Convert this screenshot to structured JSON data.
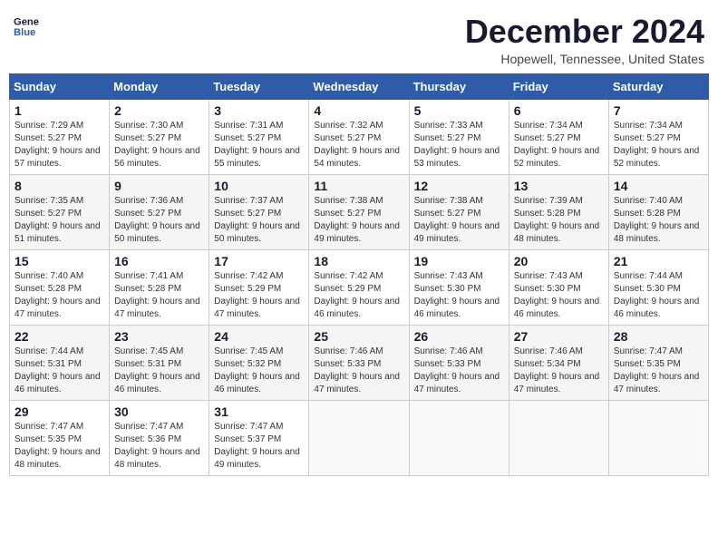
{
  "header": {
    "logo_line1": "General",
    "logo_line2": "Blue",
    "month_title": "December 2024",
    "location": "Hopewell, Tennessee, United States"
  },
  "weekdays": [
    "Sunday",
    "Monday",
    "Tuesday",
    "Wednesday",
    "Thursday",
    "Friday",
    "Saturday"
  ],
  "weeks": [
    [
      {
        "day": "1",
        "sunrise": "7:29 AM",
        "sunset": "5:27 PM",
        "daylight": "9 hours and 57 minutes."
      },
      {
        "day": "2",
        "sunrise": "7:30 AM",
        "sunset": "5:27 PM",
        "daylight": "9 hours and 56 minutes."
      },
      {
        "day": "3",
        "sunrise": "7:31 AM",
        "sunset": "5:27 PM",
        "daylight": "9 hours and 55 minutes."
      },
      {
        "day": "4",
        "sunrise": "7:32 AM",
        "sunset": "5:27 PM",
        "daylight": "9 hours and 54 minutes."
      },
      {
        "day": "5",
        "sunrise": "7:33 AM",
        "sunset": "5:27 PM",
        "daylight": "9 hours and 53 minutes."
      },
      {
        "day": "6",
        "sunrise": "7:34 AM",
        "sunset": "5:27 PM",
        "daylight": "9 hours and 52 minutes."
      },
      {
        "day": "7",
        "sunrise": "7:34 AM",
        "sunset": "5:27 PM",
        "daylight": "9 hours and 52 minutes."
      }
    ],
    [
      {
        "day": "8",
        "sunrise": "7:35 AM",
        "sunset": "5:27 PM",
        "daylight": "9 hours and 51 minutes."
      },
      {
        "day": "9",
        "sunrise": "7:36 AM",
        "sunset": "5:27 PM",
        "daylight": "9 hours and 50 minutes."
      },
      {
        "day": "10",
        "sunrise": "7:37 AM",
        "sunset": "5:27 PM",
        "daylight": "9 hours and 50 minutes."
      },
      {
        "day": "11",
        "sunrise": "7:38 AM",
        "sunset": "5:27 PM",
        "daylight": "9 hours and 49 minutes."
      },
      {
        "day": "12",
        "sunrise": "7:38 AM",
        "sunset": "5:27 PM",
        "daylight": "9 hours and 49 minutes."
      },
      {
        "day": "13",
        "sunrise": "7:39 AM",
        "sunset": "5:28 PM",
        "daylight": "9 hours and 48 minutes."
      },
      {
        "day": "14",
        "sunrise": "7:40 AM",
        "sunset": "5:28 PM",
        "daylight": "9 hours and 48 minutes."
      }
    ],
    [
      {
        "day": "15",
        "sunrise": "7:40 AM",
        "sunset": "5:28 PM",
        "daylight": "9 hours and 47 minutes."
      },
      {
        "day": "16",
        "sunrise": "7:41 AM",
        "sunset": "5:28 PM",
        "daylight": "9 hours and 47 minutes."
      },
      {
        "day": "17",
        "sunrise": "7:42 AM",
        "sunset": "5:29 PM",
        "daylight": "9 hours and 47 minutes."
      },
      {
        "day": "18",
        "sunrise": "7:42 AM",
        "sunset": "5:29 PM",
        "daylight": "9 hours and 46 minutes."
      },
      {
        "day": "19",
        "sunrise": "7:43 AM",
        "sunset": "5:30 PM",
        "daylight": "9 hours and 46 minutes."
      },
      {
        "day": "20",
        "sunrise": "7:43 AM",
        "sunset": "5:30 PM",
        "daylight": "9 hours and 46 minutes."
      },
      {
        "day": "21",
        "sunrise": "7:44 AM",
        "sunset": "5:30 PM",
        "daylight": "9 hours and 46 minutes."
      }
    ],
    [
      {
        "day": "22",
        "sunrise": "7:44 AM",
        "sunset": "5:31 PM",
        "daylight": "9 hours and 46 minutes."
      },
      {
        "day": "23",
        "sunrise": "7:45 AM",
        "sunset": "5:31 PM",
        "daylight": "9 hours and 46 minutes."
      },
      {
        "day": "24",
        "sunrise": "7:45 AM",
        "sunset": "5:32 PM",
        "daylight": "9 hours and 46 minutes."
      },
      {
        "day": "25",
        "sunrise": "7:46 AM",
        "sunset": "5:33 PM",
        "daylight": "9 hours and 47 minutes."
      },
      {
        "day": "26",
        "sunrise": "7:46 AM",
        "sunset": "5:33 PM",
        "daylight": "9 hours and 47 minutes."
      },
      {
        "day": "27",
        "sunrise": "7:46 AM",
        "sunset": "5:34 PM",
        "daylight": "9 hours and 47 minutes."
      },
      {
        "day": "28",
        "sunrise": "7:47 AM",
        "sunset": "5:35 PM",
        "daylight": "9 hours and 47 minutes."
      }
    ],
    [
      {
        "day": "29",
        "sunrise": "7:47 AM",
        "sunset": "5:35 PM",
        "daylight": "9 hours and 48 minutes."
      },
      {
        "day": "30",
        "sunrise": "7:47 AM",
        "sunset": "5:36 PM",
        "daylight": "9 hours and 48 minutes."
      },
      {
        "day": "31",
        "sunrise": "7:47 AM",
        "sunset": "5:37 PM",
        "daylight": "9 hours and 49 minutes."
      },
      null,
      null,
      null,
      null
    ]
  ],
  "labels": {
    "sunrise": "Sunrise:",
    "sunset": "Sunset:",
    "daylight": "Daylight:"
  }
}
